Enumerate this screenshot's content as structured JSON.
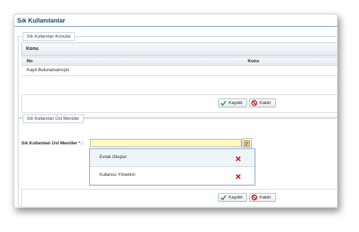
{
  "window": {
    "title": "Sık Kullanılanlar"
  },
  "topics": {
    "legend": "Sık Kullanılan Konular",
    "grid_title": "Konu",
    "columns": [
      "No",
      "Konu"
    ],
    "empty_text": "Kayıt Bulunamamıştır",
    "save_label": "Kaydet",
    "remove_label": "Kaldır"
  },
  "menus": {
    "legend": "Sık Kullanılan Üst Menüler",
    "field_label": "Sık Kullanılan Üst Menüler",
    "required_mark": "*",
    "field_suffix": ":",
    "input_value": "",
    "dropdown_items": [
      {
        "label": "Evrak Oluştur",
        "icon": "delete-x-icon"
      },
      {
        "label": "Kullanıcı Yönetimi",
        "icon": "delete-x-icon"
      }
    ],
    "save_label": "Kaydet",
    "remove_label": "Kaldır"
  },
  "colors": {
    "title": "#1f3f6f",
    "input_highlight": "#fff9c0",
    "delete_icon": "#cc1111",
    "save_icon": "#2f9e2f",
    "remove_icon": "#cc1111"
  }
}
